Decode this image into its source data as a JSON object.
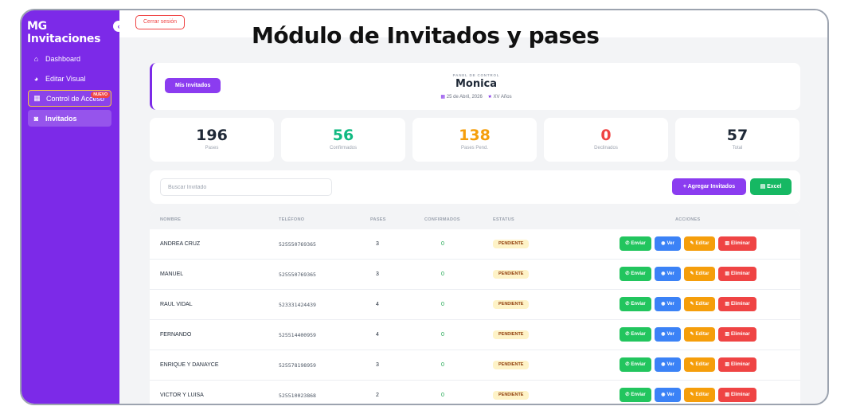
{
  "overlay_title": "Módulo de Invitados y pases",
  "sidebar": {
    "brand": "MG Invitaciones",
    "collapse_icon": "‹",
    "items": [
      {
        "label": "Dashboard",
        "icon": "home-icon",
        "glyph": "⌂"
      },
      {
        "label": "Editar Visual",
        "icon": "palette-icon",
        "glyph": "◕"
      },
      {
        "label": "Control de Acceso",
        "icon": "qr-icon",
        "glyph": "▦",
        "badge": "NUEVO"
      },
      {
        "label": "Invitados",
        "icon": "users-icon",
        "glyph": "◙"
      }
    ]
  },
  "topbar": {
    "logout_label": "Cerrar sesión"
  },
  "panel": {
    "button_label": "Mis Invitados",
    "label": "PANEL DE CONTROL",
    "name": "Monica",
    "date": "25 de Abril, 2026",
    "event": "XV Años"
  },
  "stats": [
    {
      "value": "196",
      "label": "Pases",
      "color": "#1f2937"
    },
    {
      "value": "56",
      "label": "Confirmados",
      "color": "#10b981"
    },
    {
      "value": "138",
      "label": "Pases Pend.",
      "color": "#f59e0b"
    },
    {
      "value": "0",
      "label": "Declinados",
      "color": "#ef4444"
    },
    {
      "value": "57",
      "label": "Total",
      "color": "#1f2937"
    }
  ],
  "toolbar": {
    "search_placeholder": "Buscar Invitado",
    "add_label": "+ Agregar Invitados",
    "excel_label": "Excel"
  },
  "table": {
    "headers": {
      "name": "NOMBRE",
      "phone": "TELÉFONO",
      "passes": "PASES",
      "confirmed": "CONFIRMADOS",
      "status": "ESTATUS",
      "actions": "ACCIONES"
    },
    "action_labels": {
      "send": "Enviar",
      "view": "Ver",
      "edit": "Editar",
      "delete": "Eliminar"
    },
    "rows": [
      {
        "name": "ANDREA CRUZ",
        "phone": "525550769365",
        "passes": "3",
        "confirmed": "0",
        "status": "PENDIENTE"
      },
      {
        "name": "MANUEL",
        "phone": "525550769365",
        "passes": "3",
        "confirmed": "0",
        "status": "PENDIENTE"
      },
      {
        "name": "RAUL VIDAL",
        "phone": "523331424439",
        "passes": "4",
        "confirmed": "0",
        "status": "PENDIENTE"
      },
      {
        "name": "FERNANDO",
        "phone": "525514400959",
        "passes": "4",
        "confirmed": "0",
        "status": "PENDIENTE"
      },
      {
        "name": "ENRIQUE Y DANAYCE",
        "phone": "525578198959",
        "passes": "3",
        "confirmed": "0",
        "status": "PENDIENTE"
      },
      {
        "name": "VICTOR Y LUISA",
        "phone": "525510023868",
        "passes": "2",
        "confirmed": "0",
        "status": "PENDIENTE"
      }
    ]
  },
  "colors": {
    "accent": "#7c2ae8",
    "success": "#22c55e",
    "info": "#3b82f6",
    "warning": "#f59e0b",
    "danger": "#ef4444"
  }
}
